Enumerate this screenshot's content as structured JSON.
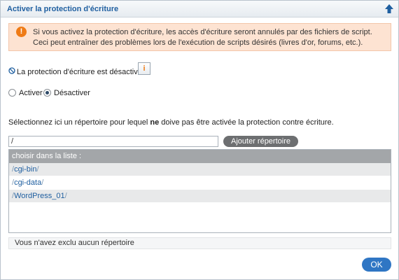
{
  "dialog": {
    "title": "Activer la protection d'écriture"
  },
  "warning": {
    "icon": "exclamation-icon",
    "text": "Si vous activez la protection d'écriture, les accès d'écriture seront annulés par des fichiers de script. Ceci peut entraîner des problèmes lors de l'exécution de scripts désirés (livres d'or, forums, etc.)."
  },
  "status": {
    "icon": "stop-icon",
    "text": "La protection d'écriture est désactivé.",
    "info_icon": "info-icon"
  },
  "options": {
    "activate_label": "Activer",
    "deactivate_label": "Désactiver",
    "selected": "Désactiver"
  },
  "instruction": {
    "before": "Sélectionnez ici un répertoire pour lequel ",
    "bold": "ne",
    "after": " doive pas être activée la protection contre écriture."
  },
  "path_input": {
    "value": "/"
  },
  "add_button": {
    "label": "Ajouter répertoire"
  },
  "list": {
    "header": "choisir dans la liste :",
    "items": [
      {
        "prefix": "/",
        "name": "cgi-bin",
        "suffix": "/"
      },
      {
        "prefix": "/",
        "name": "cgi-data",
        "suffix": "/"
      },
      {
        "prefix": "/",
        "name": "WordPress_01",
        "suffix": "/"
      }
    ]
  },
  "excluded_text": "Vous n'avez exclu aucun répertoire",
  "ok_button": {
    "label": "OK"
  },
  "colors": {
    "accent": "#2f76c4",
    "title_blue": "#1f5fa0",
    "warning_bg": "#fde3d2",
    "warning_icon": "#ef7b16"
  }
}
